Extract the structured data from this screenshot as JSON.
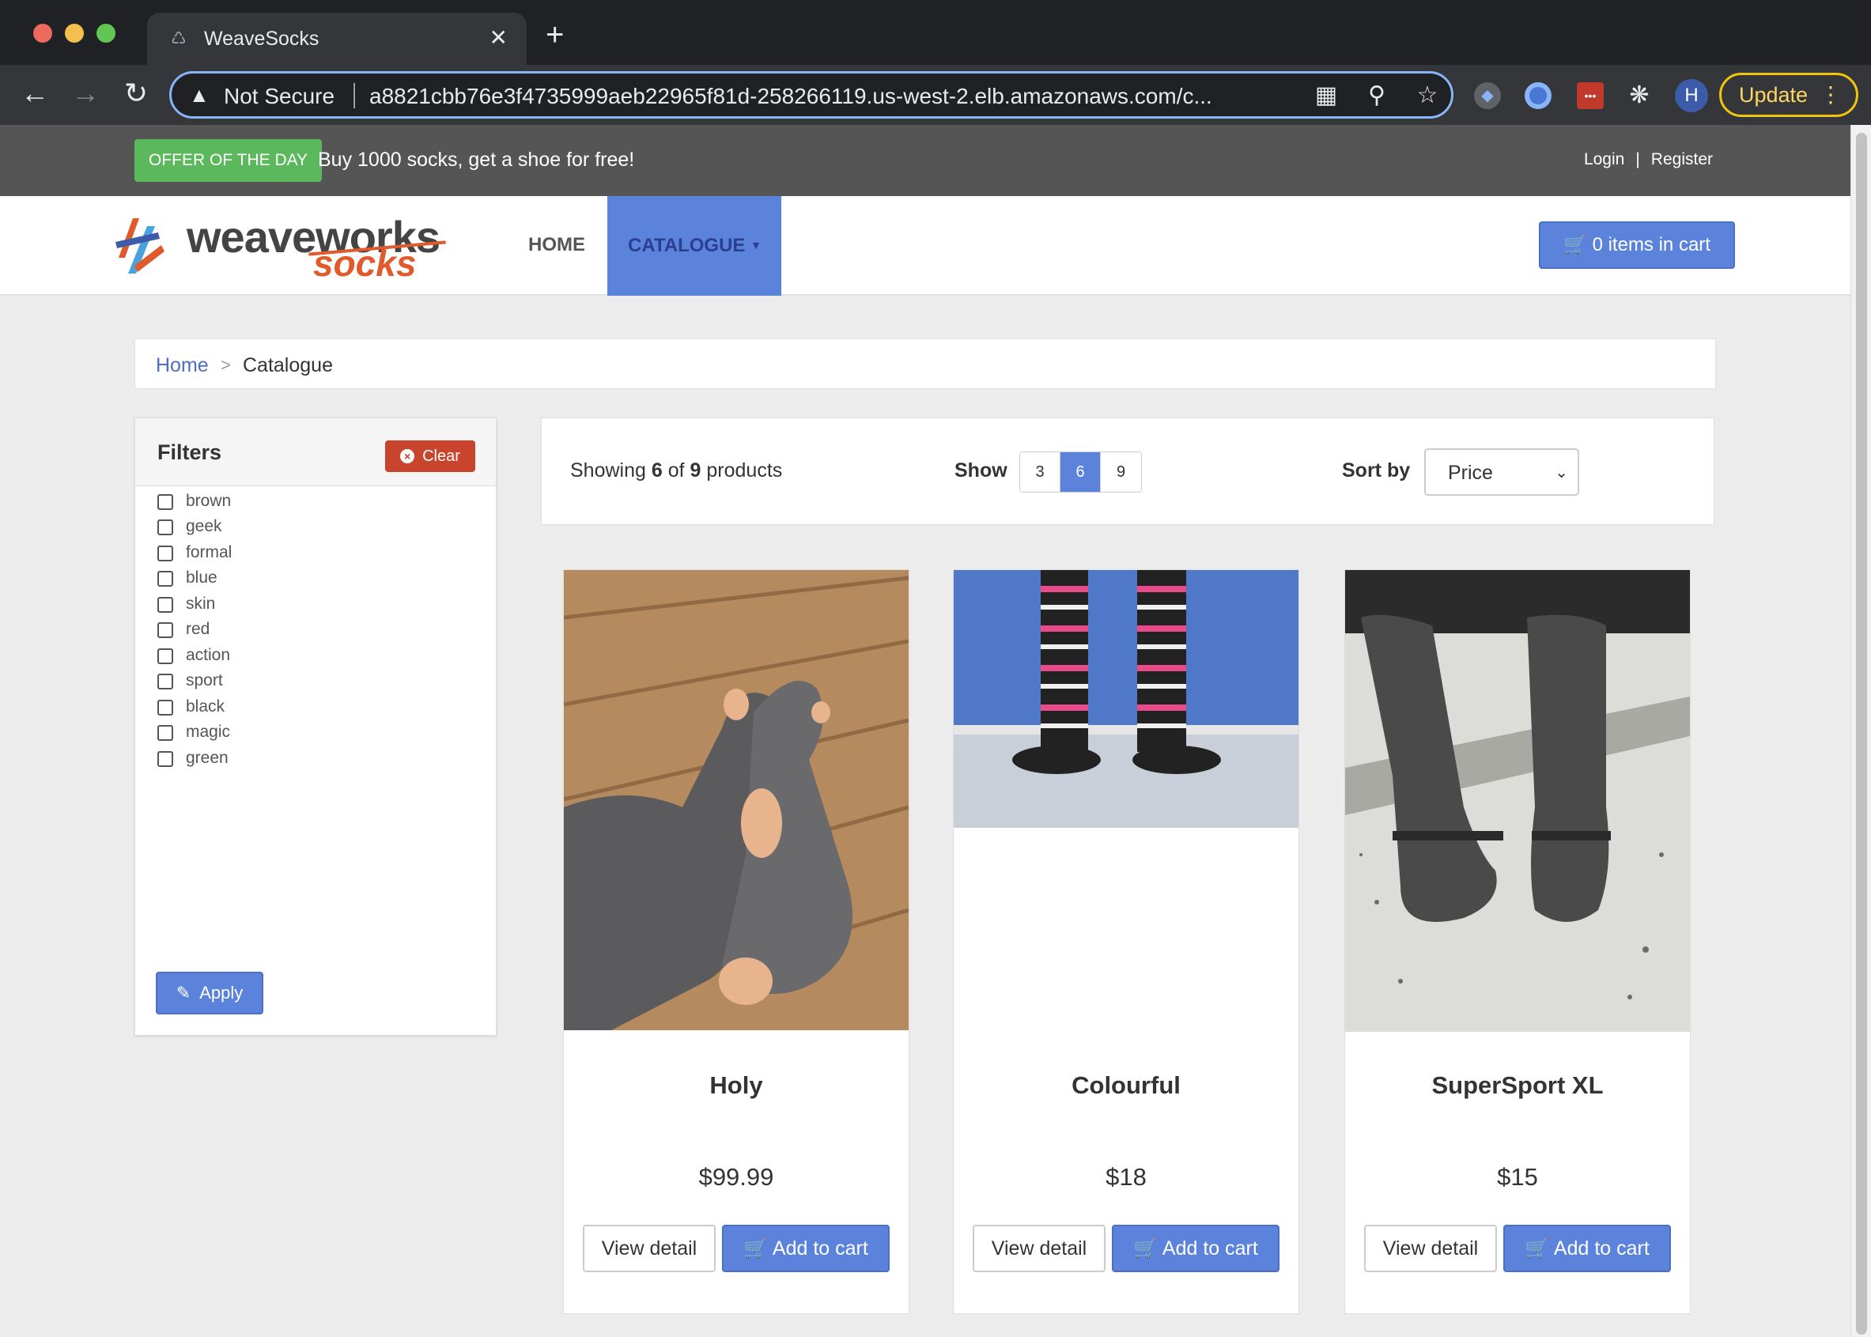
{
  "browser": {
    "tab_title": "WeaveSocks",
    "security_label": "Not Secure",
    "url": "a8821cbb76e3f4735999aeb22965f81d-258266119.us-west-2.elb.amazonaws.com/c...",
    "profile_initial": "H",
    "update_label": "Update"
  },
  "topbar": {
    "offer_badge": "OFFER OF THE DAY",
    "offer_text": "Buy 1000 socks, get a shoe for free!",
    "login": "Login",
    "separator": "|",
    "register": "Register"
  },
  "navbar": {
    "logo_main": "weaveworks",
    "logo_sub": "socks",
    "home": "HOME",
    "catalogue": "CATALOGUE",
    "cart": "0 items in cart"
  },
  "breadcrumb": {
    "home": "Home",
    "separator": ">",
    "current": "Catalogue"
  },
  "filters": {
    "title": "Filters",
    "clear_label": "Clear",
    "tags": [
      "brown",
      "geek",
      "formal",
      "blue",
      "skin",
      "red",
      "action",
      "sport",
      "black",
      "magic",
      "green"
    ],
    "apply_label": "Apply"
  },
  "toolbar": {
    "showing_prefix": "Showing",
    "showing_count": "6",
    "showing_of": "of",
    "showing_total": "9",
    "showing_suffix": "products",
    "show_label": "Show",
    "page_sizes": [
      "3",
      "6",
      "9"
    ],
    "active_page_size": "6",
    "sort_label": "Sort by",
    "sort_value": "Price"
  },
  "products": [
    {
      "name": "Holy",
      "price": "$99.99",
      "detail_label": "View detail",
      "add_label": "Add to cart"
    },
    {
      "name": "Colourful",
      "price": "$18",
      "detail_label": "View detail",
      "add_label": "Add to cart"
    },
    {
      "name": "SuperSport XL",
      "price": "$15",
      "detail_label": "View detail",
      "add_label": "Add to cart"
    }
  ],
  "colors": {
    "accent": "#5b83db",
    "offer_green": "#5cb85c",
    "clear_red": "#c9442c",
    "topbar": "#555555"
  }
}
